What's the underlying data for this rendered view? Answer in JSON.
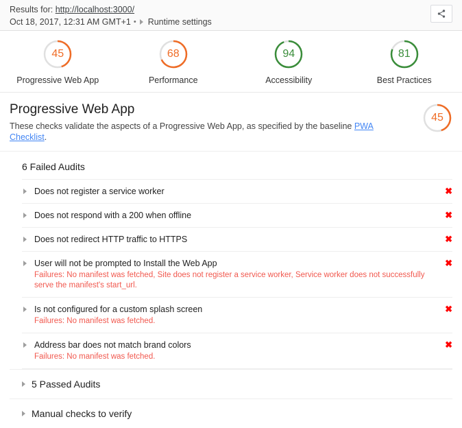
{
  "header": {
    "results_prefix": "Results for:",
    "url": "http://localhost:3000/",
    "timestamp": "Oct 18, 2017, 12:31 AM GMT+1",
    "separator": "•",
    "runtime_settings": "Runtime settings",
    "share_icon": "share-icon"
  },
  "scores": [
    {
      "value": "45",
      "label": "Progressive Web App",
      "percent": 45,
      "color": "#ef6c26"
    },
    {
      "value": "68",
      "label": "Performance",
      "percent": 68,
      "color": "#ef6c26"
    },
    {
      "value": "94",
      "label": "Accessibility",
      "percent": 94,
      "color": "#3a8d3a"
    },
    {
      "value": "81",
      "label": "Best Practices",
      "percent": 81,
      "color": "#3a8d3a"
    }
  ],
  "category": {
    "title": "Progressive Web App",
    "description_before": "These checks validate the aspects of a Progressive Web App, as specified by the baseline ",
    "description_link": "PWA Checklist",
    "description_after": ".",
    "score_value": "45",
    "score_percent": 45,
    "score_color": "#ef6c26"
  },
  "failed_group": {
    "title": "6 Failed Audits",
    "audits": [
      {
        "title": "Does not register a service worker",
        "failure": "",
        "mark": "✖"
      },
      {
        "title": "Does not respond with a 200 when offline",
        "failure": "",
        "mark": "✖"
      },
      {
        "title": "Does not redirect HTTP traffic to HTTPS",
        "failure": "",
        "mark": "✖"
      },
      {
        "title": "User will not be prompted to Install the Web App",
        "failure": "Failures: No manifest was fetched, Site does not register a service worker, Service worker does not successfully serve the manifest's start_url.",
        "mark": "✖"
      },
      {
        "title": "Is not configured for a custom splash screen",
        "failure": "Failures: No manifest was fetched.",
        "mark": "✖"
      },
      {
        "title": "Address bar does not match brand colors",
        "failure": "Failures: No manifest was fetched.",
        "mark": "✖"
      }
    ]
  },
  "collapsed_sections": [
    {
      "label": "5 Passed Audits"
    },
    {
      "label": "Manual checks to verify"
    }
  ],
  "colors": {
    "orange": "#ef6c26",
    "green": "#3a8d3a",
    "fail_red": "#f1584e",
    "x_red": "#ff0000",
    "link_blue": "#4285f4",
    "gauge_track": "#e0e0e0"
  }
}
